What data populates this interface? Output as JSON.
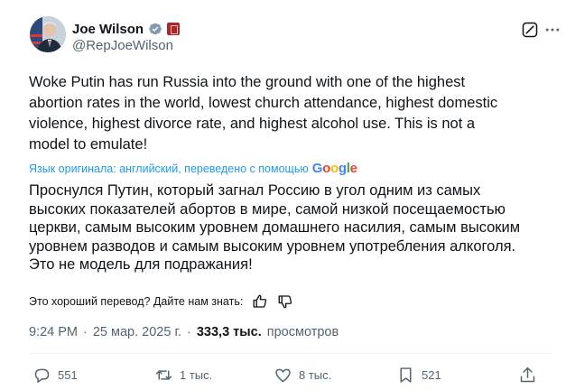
{
  "author": {
    "name": "Joe Wilson",
    "handle": "@RepJoeWilson"
  },
  "tweet": {
    "text": "Woke Putin has run Russia into the ground with one of the highest\nabortion rates in the world, lowest church attendance, highest domestic\nviolence, highest divorce rate, and highest alcohol use. This is not a\nmodel to emulate!"
  },
  "translation": {
    "note": "Язык оригинала: английский, переведено с помощью",
    "provider": "Google",
    "text": "Проснулся Путин, который загнал Россию в угол одним из самых\nвысоких показателей абортов в мире, самой низкой посещаемостью\nцеркви, самым высоким уровнем домашнего насилия, самым высоким\nуровнем разводов и самым высоким уровнем употребления алкоголя.\nЭто не модель для подражания!",
    "feedback": "Это хороший перевод? Дайте нам знать:"
  },
  "meta": {
    "time": "9:24 PM",
    "date": "25 мар. 2025 г.",
    "views_count": "333,3 тыс.",
    "views_label": "просмотров"
  },
  "actions": {
    "replies": "551",
    "reposts": "1 тыс.",
    "likes": "8 тыс.",
    "bookmarks": "521"
  },
  "colors": {
    "accent": "#1d9bf0",
    "text": "#0f1419",
    "muted": "#536471"
  }
}
